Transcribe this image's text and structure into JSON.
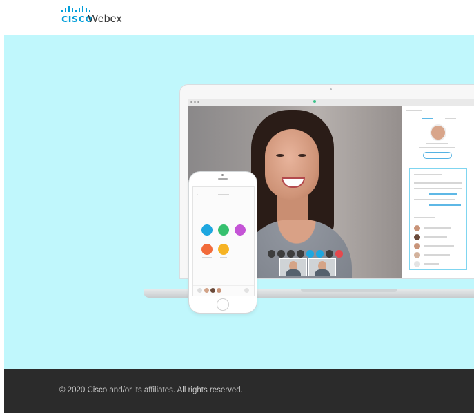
{
  "header": {
    "brand": {
      "cisco": "CISCO",
      "product": "Webex"
    }
  },
  "colors": {
    "hero_background": "#c0f7fc",
    "footer_background": "#2b2b2b",
    "cisco_blue": "#049fd9"
  },
  "footer": {
    "copyright": "© 2020 Cisco and/or its affiliates. All rights reserved."
  }
}
